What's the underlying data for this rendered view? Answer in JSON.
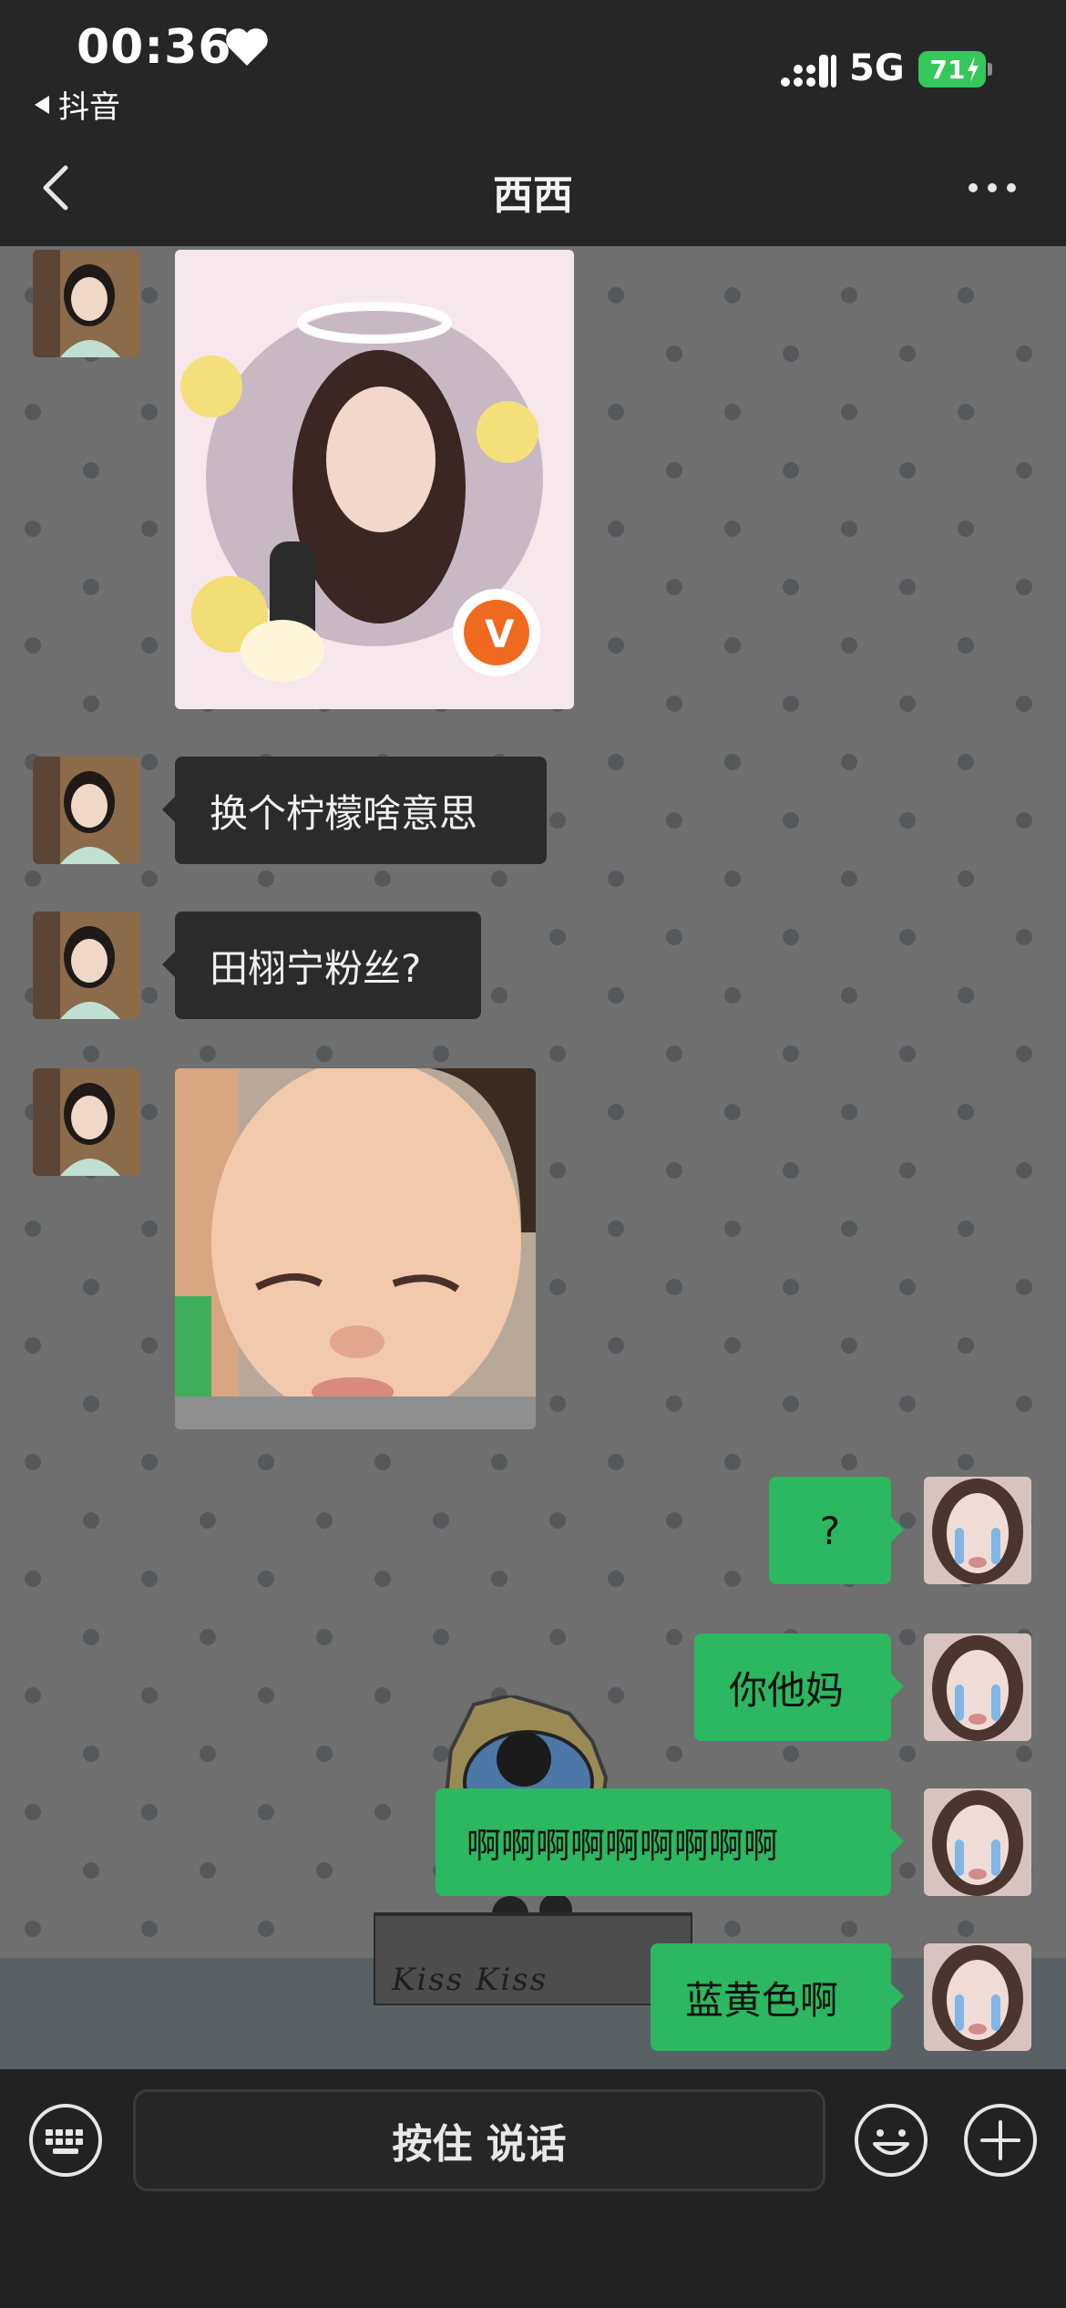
{
  "status_bar": {
    "time": "00:36",
    "back_app": "抖音",
    "network": "5G",
    "battery": "71"
  },
  "nav": {
    "title": "西西"
  },
  "messages": [
    {
      "side": "in",
      "type": "image",
      "desc": "sticker"
    },
    {
      "side": "in",
      "type": "text",
      "text": "换个柠檬啥意思"
    },
    {
      "side": "in",
      "type": "text",
      "text": "田栩宁粉丝?"
    },
    {
      "side": "in",
      "type": "image",
      "desc": "baby sticker"
    },
    {
      "side": "out",
      "type": "text",
      "text": "?"
    },
    {
      "side": "out",
      "type": "text",
      "text": "你他妈"
    },
    {
      "side": "out",
      "type": "text",
      "text": "啊啊啊啊啊啊啊啊啊"
    },
    {
      "side": "out",
      "type": "text",
      "text": "蓝黄色啊"
    }
  ],
  "sticker_watermark": "Kiss  Kiss",
  "input_bar": {
    "voice_label": "按住 说话"
  },
  "colors": {
    "outgoing_bubble": "#2bb860",
    "incoming_bubble": "#2b2b2b",
    "chat_background": "#6f6f6f"
  },
  "icons": [
    "heart-icon",
    "signal-icon",
    "battery-icon",
    "back-chevron-icon",
    "more-icon",
    "keyboard-icon",
    "emoji-icon",
    "plus-icon"
  ]
}
